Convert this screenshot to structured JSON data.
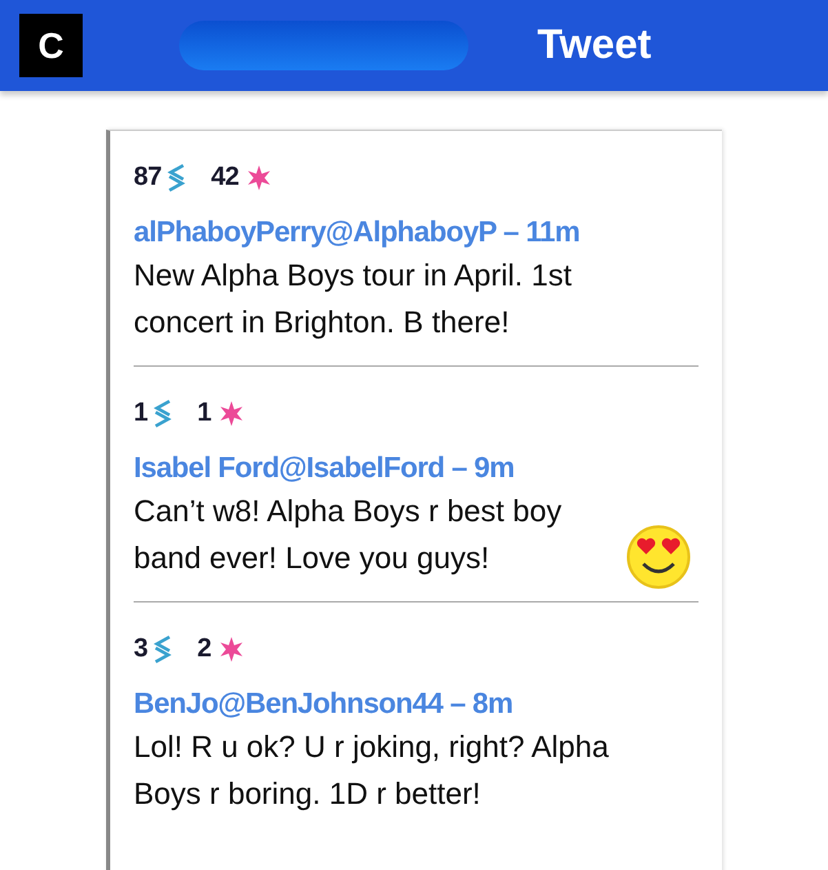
{
  "header": {
    "logo": "C",
    "title": "Tweet"
  },
  "tweets": [
    {
      "retweets": "87",
      "likes": "42",
      "author": "alPhaboyPerry@AlphaboyP – 11m",
      "text": "New Alpha Boys tour in April. 1st concert in Brighton. B there!",
      "emoji": false
    },
    {
      "retweets": "1",
      "likes": "1",
      "author": "Isabel Ford@IsabelFord – 9m",
      "text": "Can’t w8! Alpha Boys r best boy band ever! Love you guys!",
      "emoji": true
    },
    {
      "retweets": "3",
      "likes": "2",
      "author": "BenJo@BenJohnson44 – 8m",
      "text": "Lol! R u ok? U r joking, right? Alpha Boys r boring. 1D r better!",
      "emoji": false
    }
  ]
}
